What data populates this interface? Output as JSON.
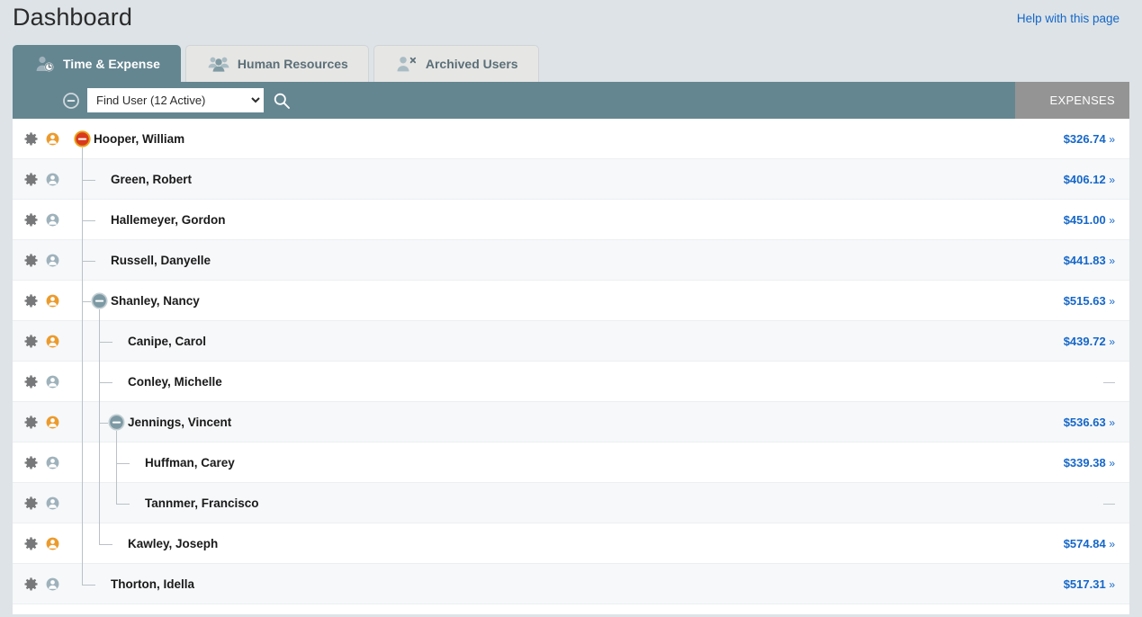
{
  "header": {
    "title": "Dashboard",
    "help_link": "Help with this page"
  },
  "tabs": [
    {
      "label": "Time & Expense",
      "icon": "person-clock-icon",
      "active": true
    },
    {
      "label": "Human Resources",
      "icon": "people-group-icon",
      "active": false
    },
    {
      "label": "Archived Users",
      "icon": "person-x-icon",
      "active": false
    }
  ],
  "toolbar": {
    "collapse_icon": "minus-circle-icon",
    "find_user_value": "Find User (12 Active)",
    "find_user_options": [
      "Find User (12 Active)"
    ],
    "search_icon": "search-icon",
    "expenses_column_header": "EXPENSES"
  },
  "colors": {
    "accent": "#648691",
    "page_background": "#dde3e7",
    "link": "#1667c8",
    "manager_person": "#eb9b2d",
    "staff_person": "#9fb2bb",
    "root_toggle": "#d93a1e",
    "root_toggle_ring": "#e8a317",
    "branch_toggle": "#7d9aa4",
    "column_header_bg": "#949494",
    "alt_row": "#f6f8fa"
  },
  "rows": [
    {
      "name": "Hooper, William",
      "depth": 0,
      "person": "manager",
      "toggle": "root-expanded",
      "amount": "$326.74",
      "chevron": "»"
    },
    {
      "name": "Green, Robert",
      "depth": 1,
      "person": "staff",
      "toggle": "none",
      "amount": "$406.12",
      "chevron": "»"
    },
    {
      "name": "Hallemeyer, Gordon",
      "depth": 1,
      "person": "staff",
      "toggle": "none",
      "amount": "$451.00",
      "chevron": "»"
    },
    {
      "name": "Russell, Danyelle",
      "depth": 1,
      "person": "staff",
      "toggle": "none",
      "amount": "$441.83",
      "chevron": "»"
    },
    {
      "name": "Shanley, Nancy",
      "depth": 1,
      "person": "manager",
      "toggle": "branch-expanded",
      "amount": "$515.63",
      "chevron": "»"
    },
    {
      "name": "Canipe, Carol",
      "depth": 2,
      "person": "manager",
      "toggle": "none",
      "amount": "$439.72",
      "chevron": "»"
    },
    {
      "name": "Conley, Michelle",
      "depth": 2,
      "person": "staff",
      "toggle": "none",
      "amount": "—",
      "chevron": ""
    },
    {
      "name": "Jennings, Vincent",
      "depth": 2,
      "person": "manager",
      "toggle": "branch-expanded",
      "amount": "$536.63",
      "chevron": "»"
    },
    {
      "name": "Huffman, Carey",
      "depth": 3,
      "person": "staff",
      "toggle": "none",
      "amount": "$339.38",
      "chevron": "»"
    },
    {
      "name": "Tannmer, Francisco",
      "depth": 3,
      "person": "staff",
      "toggle": "none",
      "amount": "—",
      "chevron": ""
    },
    {
      "name": "Kawley, Joseph",
      "depth": 2,
      "person": "manager",
      "toggle": "none",
      "amount": "$574.84",
      "chevron": "»"
    },
    {
      "name": "Thorton, Idella",
      "depth": 1,
      "person": "staff",
      "toggle": "none",
      "amount": "$517.31",
      "chevron": "»"
    }
  ]
}
